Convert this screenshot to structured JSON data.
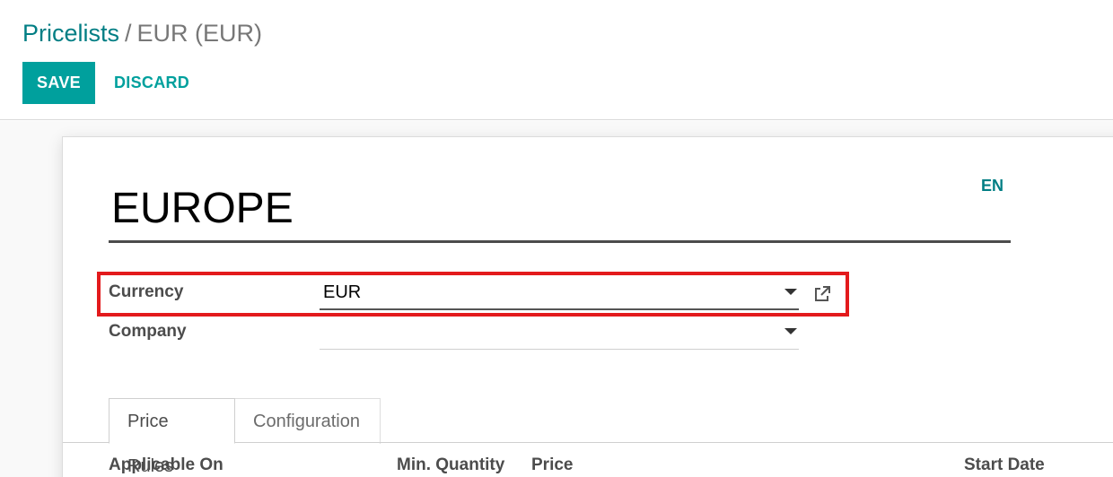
{
  "breadcrumb": {
    "parent": "Pricelists",
    "separator": "/",
    "current": "EUR (EUR)"
  },
  "buttons": {
    "save": "SAVE",
    "discard": "DISCARD"
  },
  "form": {
    "name": "EUROPE",
    "language_button": "EN",
    "fields": {
      "currency": {
        "label": "Currency",
        "value": "EUR"
      },
      "company": {
        "label": "Company",
        "value": ""
      }
    },
    "highlight_color": "#e31a1c"
  },
  "tabs": [
    {
      "label": "Price Rules",
      "active": true
    },
    {
      "label": "Configuration",
      "active": false
    }
  ],
  "table": {
    "columns": [
      "Applicable On",
      "Min. Quantity",
      "Price",
      "Start Date"
    ]
  },
  "colors": {
    "primary": "#00a09d",
    "link": "#017e84"
  }
}
